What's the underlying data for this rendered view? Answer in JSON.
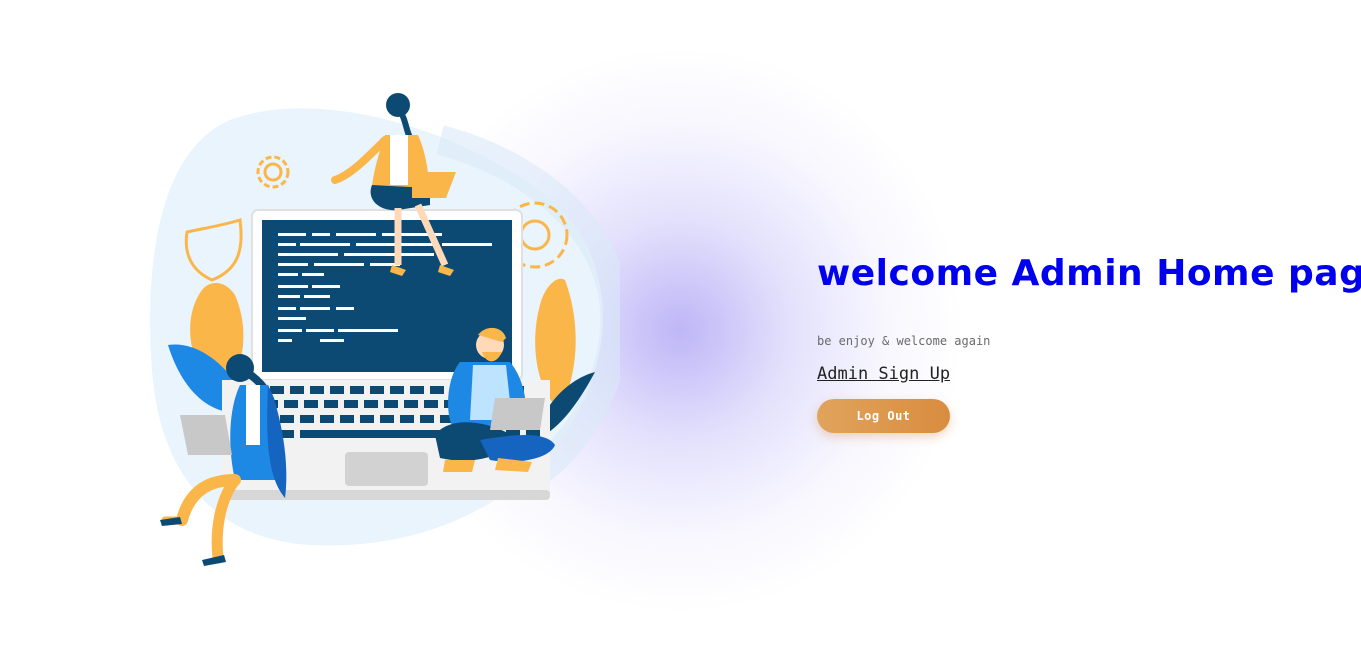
{
  "main": {
    "title": "welcome Admin Home page",
    "subtitle": "be enjoy & welcome again",
    "signup_link": "Admin Sign Up",
    "logout_label": "Log Out"
  },
  "illustration": {
    "icon": "people-working-on-laptop-illustration"
  },
  "colors": {
    "title": "#0000ee",
    "button": "#dd9a50",
    "glow": "#b8b2f5",
    "laptop_screen": "#0c4a73",
    "accent_yellow": "#fbb64a",
    "accent_blue": "#1e88e5"
  }
}
